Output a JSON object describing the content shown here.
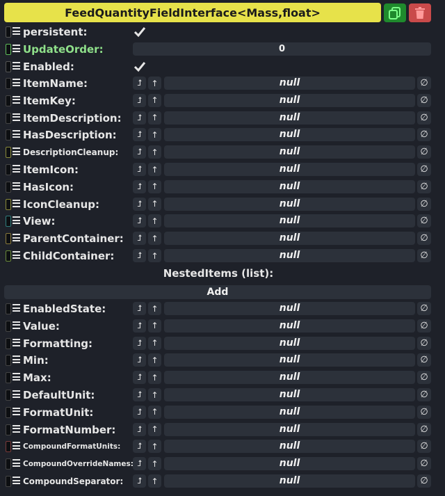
{
  "header": {
    "title": "FeedQuantityFieldInterface<Mass,float>"
  },
  "colors": {
    "header_bg": "#e7e24a",
    "duplicate_bg": "#1f8a2d",
    "delete_bg": "#c94a4a"
  },
  "icons": {
    "duplicate": "duplicate-icon",
    "delete": "trash-icon",
    "reference": "reference-icon",
    "parent": "arrow-up-icon",
    "clear": "null-clear-icon"
  },
  "persistent": {
    "label": "persistent:",
    "checked": true
  },
  "update_order": {
    "label": "UpdateOrder:",
    "value": "0"
  },
  "enabled": {
    "label": "Enabled:",
    "checked": true
  },
  "null_text": "null",
  "clear_symbol": "∅",
  "ref_symbol": "⮥",
  "up_symbol": "↑",
  "fields": [
    {
      "label": "ItemName:",
      "indicator": "#444444",
      "size": "normal"
    },
    {
      "label": "ItemKey:",
      "indicator": "#444444",
      "size": "normal"
    },
    {
      "label": "ItemDescription:",
      "indicator": "#444444",
      "size": "normal"
    },
    {
      "label": "HasDescription:",
      "indicator": "#444444",
      "size": "normal"
    },
    {
      "label": "DescriptionCleanup:",
      "indicator": "#8a8a3a",
      "size": "small"
    },
    {
      "label": "ItemIcon:",
      "indicator": "#444444",
      "size": "normal"
    },
    {
      "label": "HasIcon:",
      "indicator": "#444444",
      "size": "normal"
    },
    {
      "label": "IconCleanup:",
      "indicator": "#8a8a3a",
      "size": "normal"
    },
    {
      "label": "View:",
      "indicator": "#2f7d7d",
      "size": "normal"
    },
    {
      "label": "ParentContainer:",
      "indicator": "#8a7a3a",
      "size": "normal"
    },
    {
      "label": "ChildContainer:",
      "indicator": "#6a8a3a",
      "size": "normal"
    }
  ],
  "nested": {
    "title": "NestedItems (list):",
    "add_label": "Add"
  },
  "fields2": [
    {
      "label": "EnabledState:",
      "indicator": "#444444",
      "size": "normal"
    },
    {
      "label": "Value:",
      "indicator": "#444444",
      "size": "normal"
    },
    {
      "label": "Formatting:",
      "indicator": "#444444",
      "size": "normal"
    },
    {
      "label": "Min:",
      "indicator": "#444444",
      "size": "normal"
    },
    {
      "label": "Max:",
      "indicator": "#444444",
      "size": "normal"
    },
    {
      "label": "DefaultUnit:",
      "indicator": "#444444",
      "size": "normal"
    },
    {
      "label": "FormatUnit:",
      "indicator": "#444444",
      "size": "normal"
    },
    {
      "label": "FormatNumber:",
      "indicator": "#444444",
      "size": "normal"
    },
    {
      "label": "CompoundFormatUnits:",
      "indicator": "#7a3a3a",
      "size": "xsmall"
    },
    {
      "label": "CompoundOverrideNames:",
      "indicator": "#444444",
      "size": "xsmall"
    },
    {
      "label": "CompoundSeparator:",
      "indicator": "#444444",
      "size": "small"
    }
  ]
}
